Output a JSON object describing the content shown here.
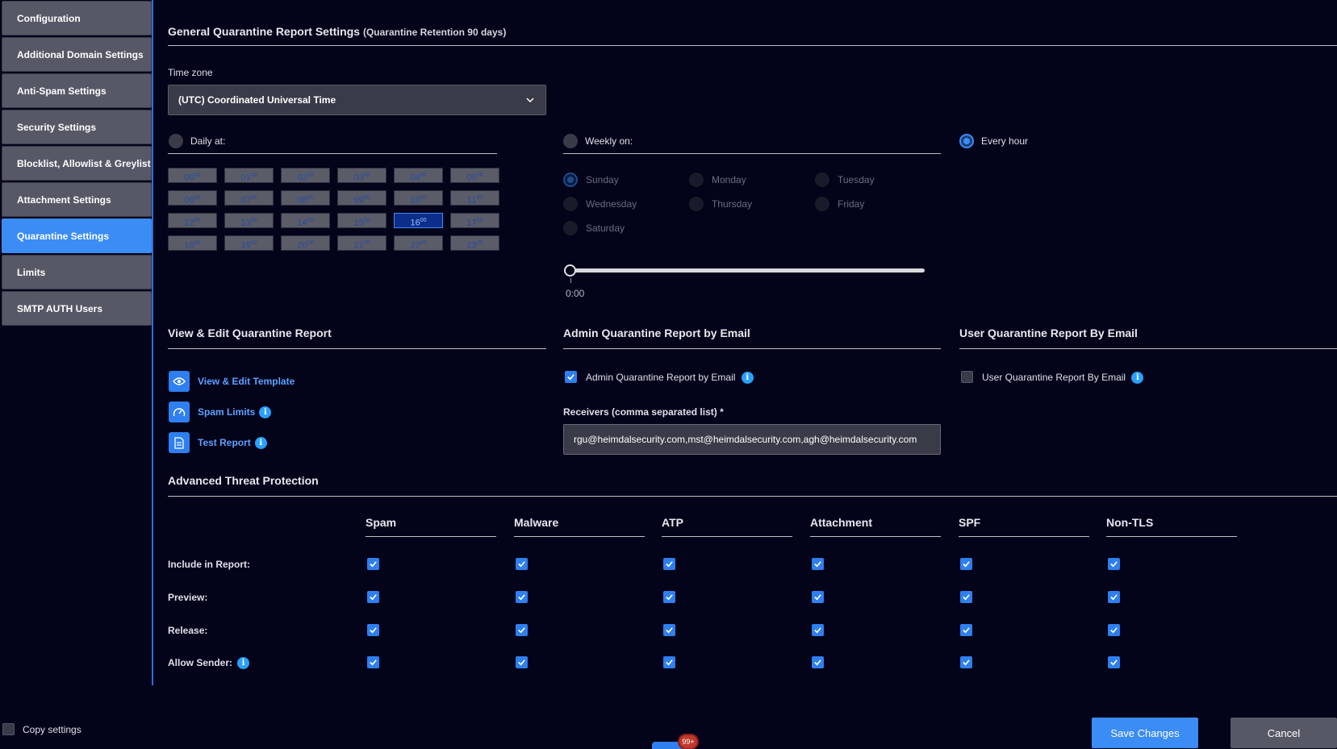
{
  "sidebar": {
    "items": [
      {
        "label": "Configuration"
      },
      {
        "label": "Additional Domain Settings"
      },
      {
        "label": "Anti-Spam Settings"
      },
      {
        "label": "Security Settings"
      },
      {
        "label": "Blocklist, Allowlist & Greylist"
      },
      {
        "label": "Attachment Settings"
      },
      {
        "label": "Quarantine Settings",
        "active": true
      },
      {
        "label": "Limits"
      },
      {
        "label": "SMTP AUTH Users"
      }
    ]
  },
  "general": {
    "title": "General Quarantine Report Settings",
    "retention": "(Quarantine Retention 90 days)",
    "timezone_label": "Time zone",
    "timezone_value": "(UTC) Coordinated Universal Time"
  },
  "schedule": {
    "daily_label": "Daily at:",
    "weekly_label": "Weekly on:",
    "hourly_label": "Every hour",
    "selected_mode": "hourly",
    "hours": [
      "00",
      "01",
      "02",
      "03",
      "04",
      "05",
      "06",
      "07",
      "08",
      "09",
      "10",
      "11",
      "12",
      "13",
      "14",
      "15",
      "16",
      "17",
      "18",
      "19",
      "20",
      "21",
      "22",
      "23"
    ],
    "hour_suffix": "00",
    "selected_hour": "16",
    "days": [
      "Sunday",
      "Monday",
      "Tuesday",
      "Wednesday",
      "Thursday",
      "Friday",
      "Saturday"
    ],
    "selected_day": "Sunday",
    "slider_value_text": "0:00",
    "slider_fraction": 0
  },
  "view_edit": {
    "title": "View & Edit Quarantine Report",
    "links": [
      {
        "label": "View & Edit Template",
        "icon": "eye-icon",
        "info": false
      },
      {
        "label": "Spam Limits",
        "icon": "gauge-icon",
        "info": true
      },
      {
        "label": "Test Report",
        "icon": "document-icon",
        "info": true
      }
    ]
  },
  "admin_report": {
    "title": "Admin Quarantine Report by Email",
    "checkbox_label": "Admin Quarantine Report by Email",
    "checked": true,
    "receivers_label": "Receivers (comma separated list) *",
    "receivers_value": "rgu@heimdalsecurity.com,mst@heimdalsecurity.com,agh@heimdalsecurity.com"
  },
  "user_report": {
    "title": "User Quarantine Report By Email",
    "checkbox_label": "User Quarantine Report By Email",
    "checked": false
  },
  "atp": {
    "title": "Advanced Threat Protection",
    "columns": [
      "Spam",
      "Malware",
      "ATP",
      "Attachment",
      "SPF",
      "Non-TLS"
    ],
    "rows": [
      {
        "label": "Include in Report:",
        "info": false,
        "values": [
          true,
          true,
          true,
          true,
          true,
          true
        ]
      },
      {
        "label": "Preview:",
        "info": false,
        "values": [
          true,
          true,
          true,
          true,
          true,
          true
        ]
      },
      {
        "label": "Release:",
        "info": false,
        "values": [
          true,
          true,
          true,
          true,
          true,
          true
        ]
      },
      {
        "label": "Allow Sender:",
        "info": true,
        "values": [
          true,
          true,
          true,
          true,
          true,
          true
        ]
      }
    ]
  },
  "footer": {
    "copy_settings_label": "Copy settings",
    "save_label": "Save Changes",
    "cancel_label": "Cancel",
    "notification_badge": "99+"
  },
  "colors": {
    "accent": "#3b8cf5",
    "background": "#03031a",
    "sidebar_item": "#575866"
  }
}
